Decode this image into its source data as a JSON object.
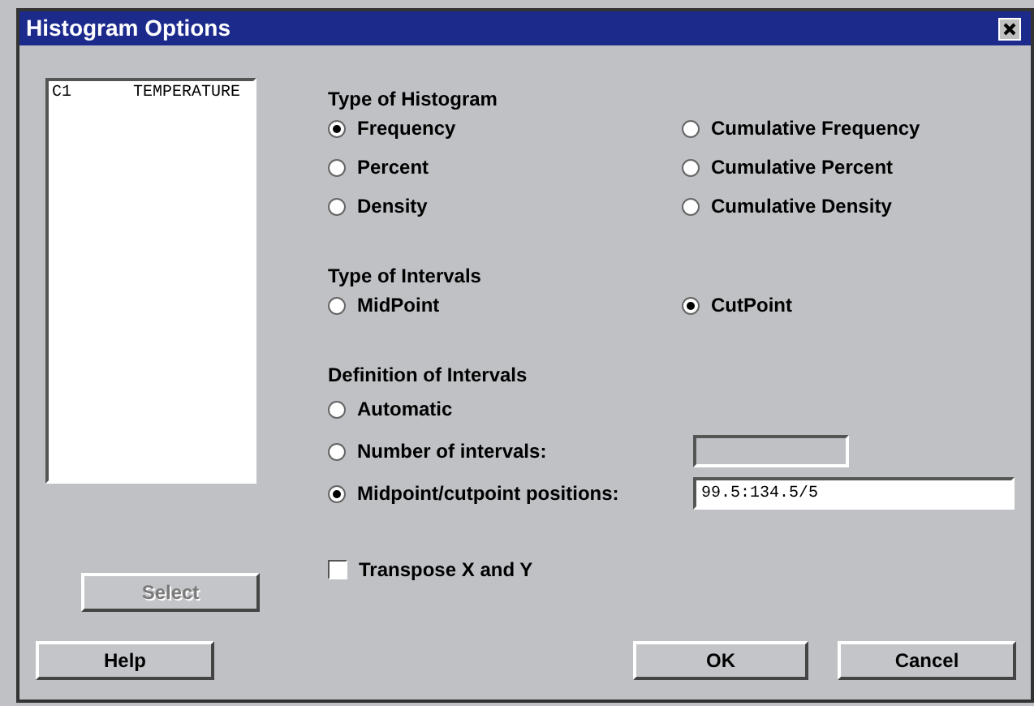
{
  "window": {
    "title": "Histogram Options"
  },
  "variables": [
    {
      "column": "C1",
      "name": "TEMPERATURE"
    }
  ],
  "histogram_type": {
    "label": "Type of Histogram",
    "options": [
      {
        "label": "Frequency",
        "selected": true
      },
      {
        "label": "Cumulative Frequency",
        "selected": false
      },
      {
        "label": "Percent",
        "selected": false
      },
      {
        "label": "Cumulative Percent",
        "selected": false
      },
      {
        "label": "Density",
        "selected": false
      },
      {
        "label": "Cumulative Density",
        "selected": false
      }
    ]
  },
  "interval_type": {
    "label": "Type of Intervals",
    "options": [
      {
        "label": "MidPoint",
        "selected": false
      },
      {
        "label": "CutPoint",
        "selected": true
      }
    ]
  },
  "interval_definition": {
    "label": "Definition of Intervals",
    "options": [
      {
        "kind": "plain",
        "label": "Automatic",
        "selected": false
      },
      {
        "kind": "field",
        "label": "Number of intervals:",
        "selected": false
      },
      {
        "kind": "field",
        "label": "Midpoint/cutpoint positions:",
        "selected": true,
        "field": "99.5:134.5/5"
      }
    ]
  },
  "transpose": {
    "label": "Transpose X and Y",
    "checked": false
  },
  "buttons": [
    {
      "label": "Select",
      "disabled": true
    },
    {
      "label": "Help",
      "disabled": false
    },
    {
      "label": "OK",
      "disabled": false
    },
    {
      "label": "Cancel",
      "disabled": false
    }
  ]
}
